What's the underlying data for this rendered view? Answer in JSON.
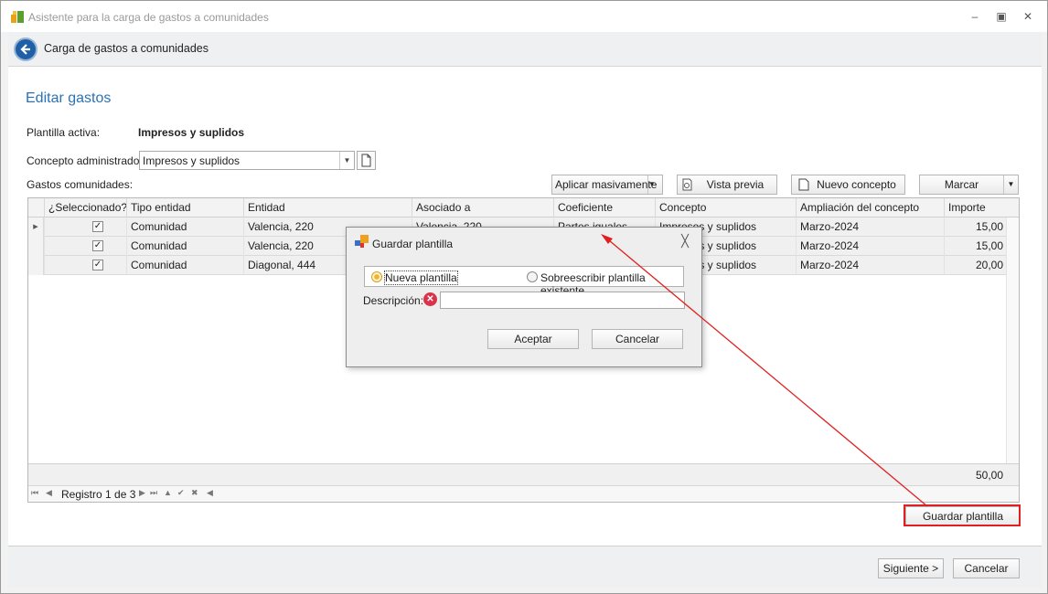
{
  "window": {
    "title": "Asistente para la carga de gastos a comunidades",
    "header_title": "Carga de gastos a comunidades"
  },
  "page": {
    "title": "Editar gastos",
    "plantilla_label": "Plantilla activa:",
    "plantilla_value": "Impresos y suplidos",
    "concepto_label": "Concepto administrador:",
    "concepto_value": "Impresos y suplidos",
    "gastos_label": "Gastos comunidades:"
  },
  "toolbar": {
    "aplicar": "Aplicar masivamente",
    "vista_previa": "Vista previa",
    "nuevo_concepto": "Nuevo concepto",
    "marcar": "Marcar"
  },
  "grid": {
    "columns": [
      "¿Seleccionado?",
      "Tipo entidad",
      "Entidad",
      "Asociado a",
      "Coeficiente",
      "Concepto",
      "Ampliación del concepto",
      "Importe"
    ],
    "rows": [
      {
        "tipo": "Comunidad",
        "entidad": "Valencia, 220",
        "asociado": "Valencia, 220",
        "coef": "Partes iguales",
        "concepto": "Impresos y suplidos",
        "ampliacion": "Marzo-2024",
        "importe": "15,00"
      },
      {
        "tipo": "Comunidad",
        "entidad": "Valencia, 220",
        "asociado": "",
        "coef": "",
        "concepto": "Impresos y suplidos",
        "ampliacion": "Marzo-2024",
        "importe": "15,00"
      },
      {
        "tipo": "Comunidad",
        "entidad": "Diagonal, 444",
        "asociado": "",
        "coef": "",
        "concepto": "Impresos y suplidos",
        "ampliacion": "Marzo-2024",
        "importe": "20,00"
      }
    ],
    "total": "50,00",
    "nav_text": "Registro 1 de 3"
  },
  "buttons": {
    "guardar_plantilla": "Guardar plantilla",
    "siguiente": "Siguiente >",
    "cancelar": "Cancelar"
  },
  "dialog": {
    "title": "Guardar plantilla",
    "radio_nueva": "Nueva plantilla",
    "radio_sobrescribir": "Sobreescribir plantilla existente",
    "descripcion_label": "Descripción:",
    "descripcion_value": "",
    "aceptar": "Aceptar",
    "cancelar": "Cancelar"
  },
  "colors": {
    "accent": "#2b72b5",
    "highlight": "#e02020"
  }
}
